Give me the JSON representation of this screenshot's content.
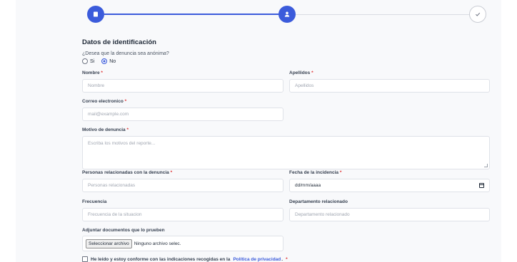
{
  "stepper": {
    "steps": [
      {
        "icon": "document-icon",
        "state": "completed"
      },
      {
        "icon": "user-icon",
        "state": "active"
      },
      {
        "icon": "check-icon",
        "state": "pending"
      }
    ],
    "accent_color": "#3b5bdb"
  },
  "form": {
    "section_title": "Datos de identificación",
    "anonymous_question": "¿Desea que la denuncia sea anónima?",
    "anonymous_options": {
      "yes": "Si",
      "no": "No",
      "selected": "No"
    },
    "required_marker": "*",
    "fields": {
      "nombre": {
        "label": "Nombre",
        "placeholder": "Nombre"
      },
      "apellidos": {
        "label": "Apellidos",
        "placeholder": "Apellidos"
      },
      "correo": {
        "label": "Correo electronico",
        "placeholder": "mail@example.com"
      },
      "motivo": {
        "label": "Motivo de denuncia",
        "placeholder": "Escriba los motivos del reporte..."
      },
      "personas": {
        "label": "Personas relacionadas con la denuncia",
        "placeholder": "Personas relacionadas"
      },
      "fecha": {
        "label": "Fecha de la incidencia",
        "value": "dd/mm/aaaa"
      },
      "frecuencia": {
        "label": "Frecuencia",
        "placeholder": "Frecuencia de la situacion"
      },
      "departamento": {
        "label": "Departamento relacionado",
        "placeholder": "Departamento relacionado"
      },
      "adjuntar": {
        "label": "Adjuntar documentos que lo prueben",
        "button": "Seleccionar archivo",
        "status": "Ninguno archivo selec."
      }
    },
    "consent": {
      "text": "He leído y estoy conforme con las indicaciones recogidas en la",
      "link": "Política de privacidad",
      "suffix": "."
    }
  }
}
